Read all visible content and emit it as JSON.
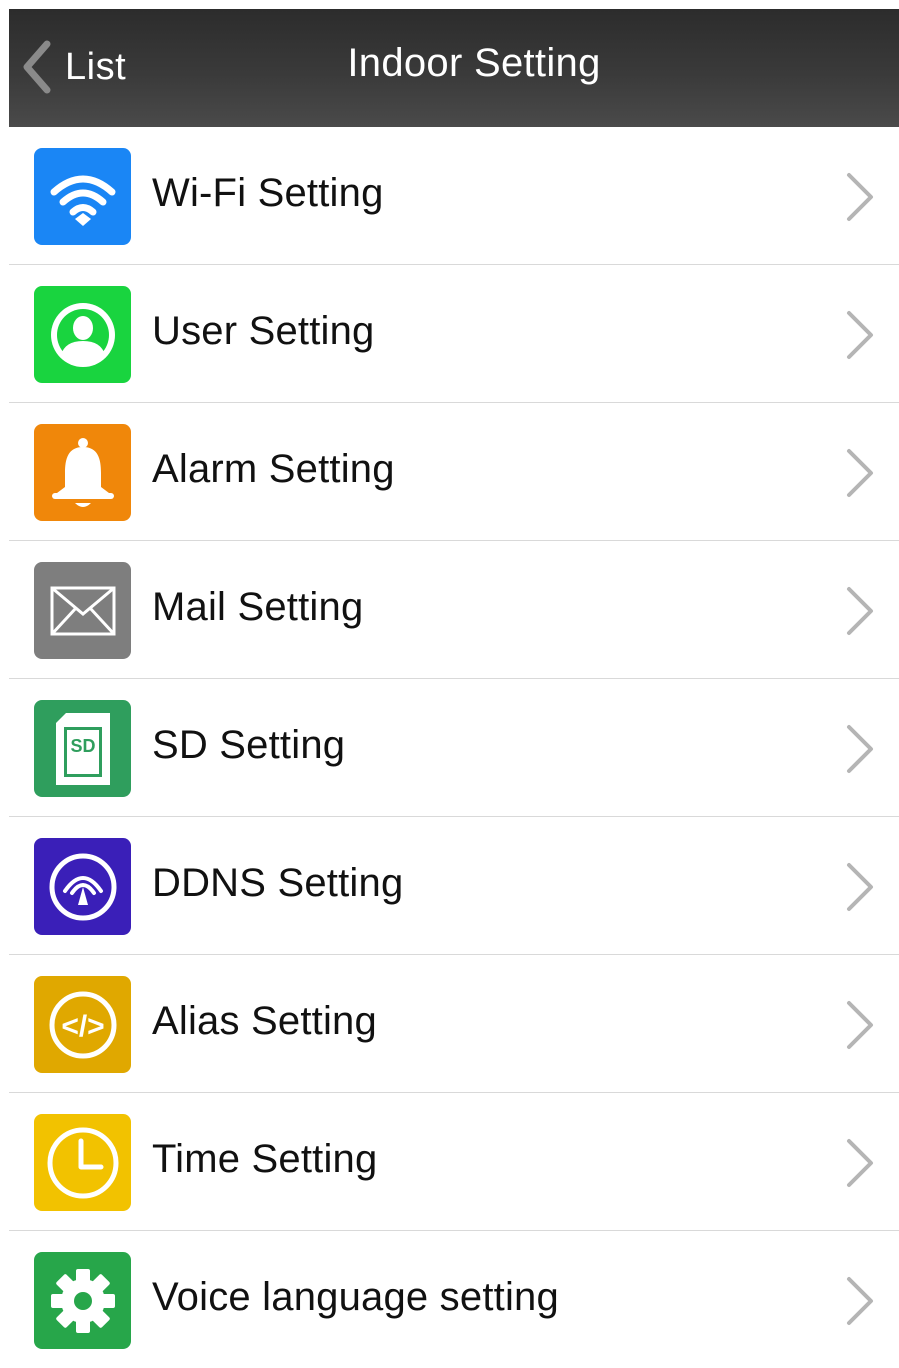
{
  "navbar": {
    "back_label": "List",
    "title": "Indoor Setting"
  },
  "colors": {
    "navbar": "#333333",
    "wifi": "#1a86f5",
    "user": "#19d43f",
    "alarm": "#f0870a",
    "mail": "#7e7e7e",
    "sd": "#2f9e5d",
    "ddns": "#3a1fb8",
    "alias": "#e0a800",
    "time": "#f2c200",
    "voice": "#27a64a",
    "chevron": "#b5b5b5",
    "divider": "#d9d9d9"
  },
  "settings": {
    "items": [
      {
        "label": "Wi-Fi Setting",
        "icon": "wifi-icon"
      },
      {
        "label": "User Setting",
        "icon": "user-icon"
      },
      {
        "label": "Alarm Setting",
        "icon": "bell-icon"
      },
      {
        "label": "Mail Setting",
        "icon": "envelope-icon"
      },
      {
        "label": "SD Setting",
        "icon": "sd-card-icon",
        "icon_text": "SD"
      },
      {
        "label": "DDNS Setting",
        "icon": "ddns-signal-icon"
      },
      {
        "label": "Alias Setting",
        "icon": "code-icon",
        "icon_text": "</>"
      },
      {
        "label": "Time Setting",
        "icon": "clock-icon"
      },
      {
        "label": "Voice language setting",
        "icon": "gear-icon"
      }
    ]
  }
}
